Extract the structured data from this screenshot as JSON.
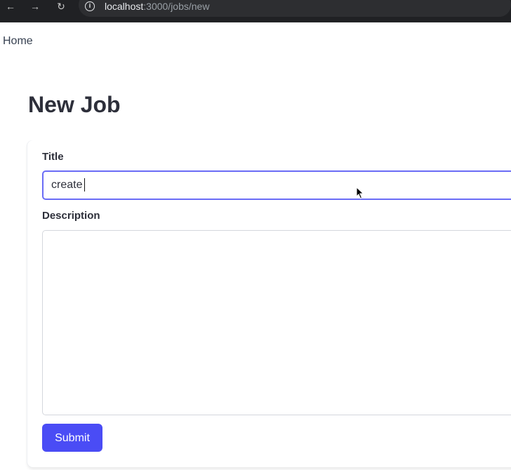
{
  "browser": {
    "nav": {
      "back_icon": "arrow-left-icon",
      "forward_icon": "arrow-right-icon",
      "reload_icon": "reload-icon"
    },
    "address": {
      "info_icon": "info-icon",
      "host": "localhost",
      "path": ":3000/jobs/new"
    }
  },
  "page": {
    "home_link": "Home",
    "title": "New Job"
  },
  "form": {
    "title_label": "Title",
    "title_value": "create",
    "description_label": "Description",
    "description_value": "",
    "submit_label": "Submit"
  },
  "colors": {
    "accent": "#4a4cf5",
    "title_text": "#2d2f3a",
    "focus_border": "#6a6cf6"
  }
}
